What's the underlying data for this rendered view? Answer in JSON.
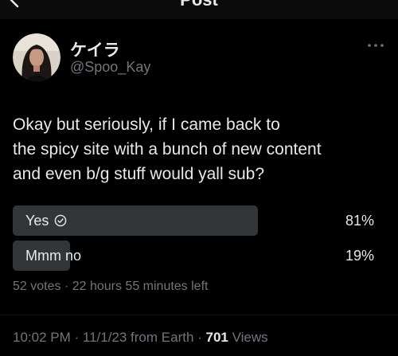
{
  "header": {
    "title": "Post"
  },
  "author": {
    "display_name": "ケイラ",
    "handle": "@Spoo_Kay"
  },
  "tweet": {
    "text_lines": [
      "Okay but seriously, if I came back to",
      "the spicy site with a bunch of new content",
      "and even b/g stuff would yall sub?"
    ]
  },
  "poll": {
    "options": [
      {
        "label": "Yes",
        "percent_text": "81%",
        "fraction": 0.81,
        "selected": true
      },
      {
        "label": "Mmm no",
        "percent_text": "19%",
        "fraction": 0.19,
        "selected": false
      }
    ],
    "summary": "52 votes · 22 hours 55 minutes left"
  },
  "meta": {
    "time_date": "10:02 PM · 11/1/23 from Earth · ",
    "views_count": "701",
    "views_label": " Views"
  },
  "colors": {
    "background": "#000000",
    "text_primary": "#e7e9ea",
    "text_secondary": "#71767b",
    "poll_fill": "#333639"
  },
  "icons": {
    "back": "arrow-left-icon",
    "more": "more-horizontal-icon",
    "selected": "check-circle-icon"
  }
}
